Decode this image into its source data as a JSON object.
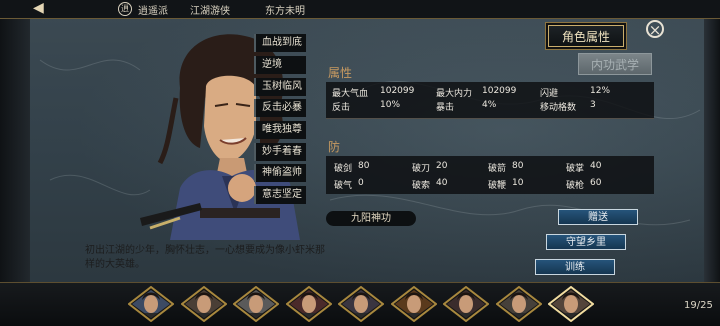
{
  "topbar": {
    "sect": "逍遥派",
    "title": "江湖游侠",
    "name": "东方未明"
  },
  "tabs": {
    "attributes": "角色属性",
    "martial": "内功武学"
  },
  "talents": [
    "血战到底",
    "逆境",
    "玉树临风",
    "反击必暴",
    "唯我独尊",
    "妙手着春",
    "神偷盗帅",
    "意志坚定"
  ],
  "attributes": {
    "heading": "属性",
    "rows": [
      [
        {
          "label": "最大气血",
          "value": "102099"
        },
        {
          "label": "最大内力",
          "value": "102099"
        },
        {
          "label": "闪避",
          "value": "12%"
        }
      ],
      [
        {
          "label": "反击",
          "value": "10%"
        },
        {
          "label": "暴击",
          "value": "4%"
        },
        {
          "label": "移动格数",
          "value": "3"
        }
      ]
    ]
  },
  "defense": {
    "heading": "防",
    "rows": [
      [
        {
          "label": "破剑",
          "value": "80"
        },
        {
          "label": "破刀",
          "value": "20"
        },
        {
          "label": "破箭",
          "value": "80"
        },
        {
          "label": "破掌",
          "value": "40"
        }
      ],
      [
        {
          "label": "破气",
          "value": "0"
        },
        {
          "label": "破索",
          "value": "40"
        },
        {
          "label": "破鞭",
          "value": "10"
        },
        {
          "label": "破枪",
          "value": "60"
        }
      ]
    ]
  },
  "skill": "九阳神功",
  "actions": {
    "gift": "赠送",
    "guard": "守望乡里",
    "train": "训练"
  },
  "description": "初出江湖的少年，胸怀壮志，一心想要成为像小虾米那样的大英雄。",
  "party_count": 9,
  "page": "19/25",
  "colors": {
    "accent_gold": "#c9ad6c",
    "heading": "#c79a61",
    "button_blue": "#26547a"
  }
}
